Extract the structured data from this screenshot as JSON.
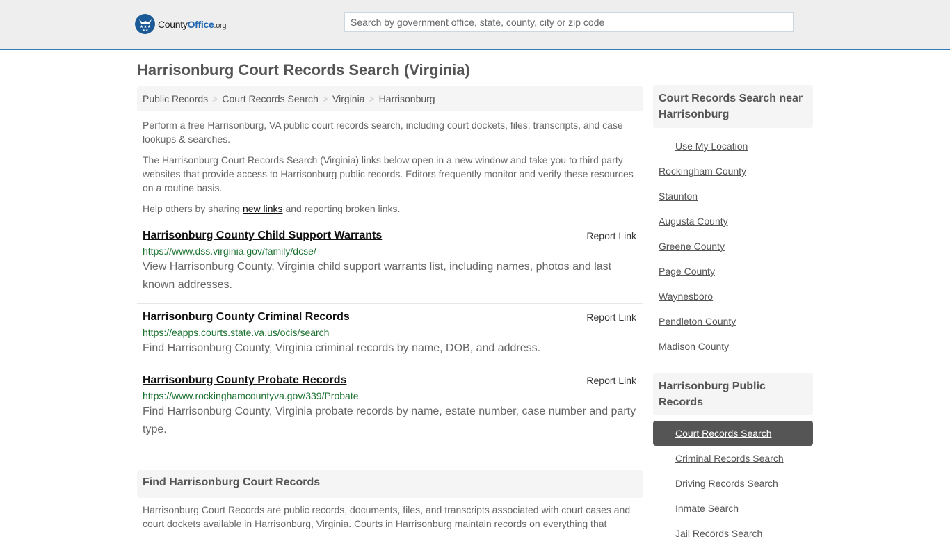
{
  "header": {
    "logo": {
      "text_main": "County",
      "text_brand": "Office",
      "text_suffix": ".org",
      "icon": "eagle-stars-badge-icon"
    },
    "search": {
      "placeholder": "Search by government office, state, county, city or zip code",
      "value": ""
    }
  },
  "page": {
    "title": "Harrisonburg Court Records Search (Virginia)"
  },
  "breadcrumb": [
    {
      "label": "Public Records"
    },
    {
      "label": "Court Records Search"
    },
    {
      "label": "Virginia"
    },
    {
      "label": "Harrisonburg"
    }
  ],
  "breadcrumb_separator": ">",
  "intro": {
    "p1": "Perform a free Harrisonburg, VA public court records search, including court dockets, files, transcripts, and case lookups & searches.",
    "p2": "The Harrisonburg Court Records Search (Virginia) links below open in a new window and take you to third party websites that provide access to Harrisonburg public records. Editors frequently monitor and verify these resources on a routine basis.",
    "p3_before": "Help others by sharing ",
    "p3_link": "new links",
    "p3_after": " and reporting broken links."
  },
  "records": [
    {
      "title": "Harrisonburg County Child Support Warrants",
      "report_label": "Report Link",
      "url": "https://www.dss.virginia.gov/family/dcse/",
      "description": "View Harrisonburg County, Virginia child support warrants list, including names, photos and last known addresses."
    },
    {
      "title": "Harrisonburg County Criminal Records",
      "report_label": "Report Link",
      "url": "https://eapps.courts.state.va.us/ocis/search",
      "description": "Find Harrisonburg County, Virginia criminal records by name, DOB, and address."
    },
    {
      "title": "Harrisonburg County Probate Records",
      "report_label": "Report Link",
      "url": "https://www.rockinghamcountyva.gov/339/Probate",
      "description": "Find Harrisonburg County, Virginia probate records by name, estate number, case number and party type."
    }
  ],
  "find_section": {
    "title": "Find Harrisonburg Court Records",
    "text": "Harrisonburg Court Records are public records, documents, files, and transcripts associated with court cases and court dockets available in Harrisonburg, Virginia. Courts in Harrisonburg maintain records on everything that"
  },
  "sidebar": {
    "nearby": {
      "title": "Court Records Search near Harrisonburg",
      "use_location": "Use My Location",
      "items": [
        "Rockingham County",
        "Staunton",
        "Augusta County",
        "Greene County",
        "Page County",
        "Waynesboro",
        "Pendleton County",
        "Madison County"
      ]
    },
    "public_records": {
      "title": "Harrisonburg Public Records",
      "active": "Court Records Search",
      "items": [
        "Criminal Records Search",
        "Driving Records Search",
        "Inmate Search",
        "Jail Records Search"
      ]
    }
  },
  "colors": {
    "accent_border": "#337ab7",
    "url_green": "#1c7230",
    "active_bg": "#555555",
    "box_bg": "#f5f5f5",
    "header_bg": "#eeeeee"
  }
}
